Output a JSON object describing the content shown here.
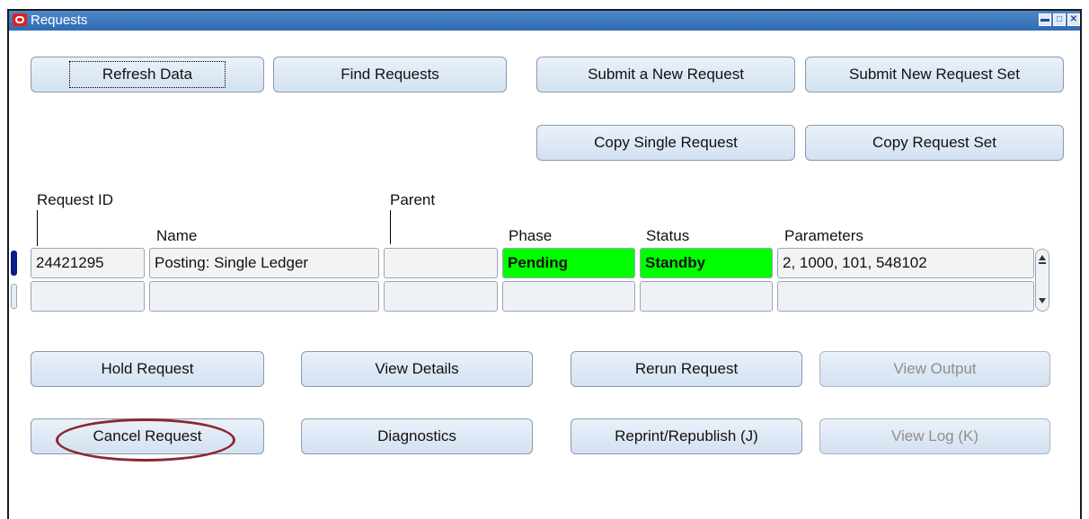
{
  "window": {
    "title": "Requests"
  },
  "title_controls": {
    "minimize": "▬",
    "maximize": "□",
    "close": "✕"
  },
  "top_buttons": {
    "refresh": "Refresh Data",
    "find": "Find Requests",
    "submit_new": "Submit a New Request",
    "submit_set": "Submit New Request Set",
    "copy_single": "Copy Single Request",
    "copy_set": "Copy Request Set"
  },
  "table": {
    "headers": {
      "request_id": "Request ID",
      "name": "Name",
      "parent": "Parent",
      "phase": "Phase",
      "status": "Status",
      "parameters": "Parameters"
    },
    "rows": [
      {
        "request_id": "24421295",
        "name": "Posting: Single Ledger",
        "parent": "",
        "phase": "Pending",
        "status": "Standby",
        "parameters": "2, 1000, 101, 548102"
      },
      {
        "request_id": "",
        "name": "",
        "parent": "",
        "phase": "",
        "status": "",
        "parameters": ""
      }
    ]
  },
  "bottom_buttons": {
    "hold": "Hold Request",
    "view_details": "View Details",
    "rerun": "Rerun Request",
    "view_output": "View Output",
    "cancel": "Cancel Request",
    "diagnostics": "Diagnostics",
    "reprint": "Reprint/Republish (J)",
    "view_log": "View Log (K)"
  },
  "colors": {
    "titlebar": "#2f6bb3",
    "status_green": "#00ff00",
    "highlight_circle": "#8b2730"
  }
}
